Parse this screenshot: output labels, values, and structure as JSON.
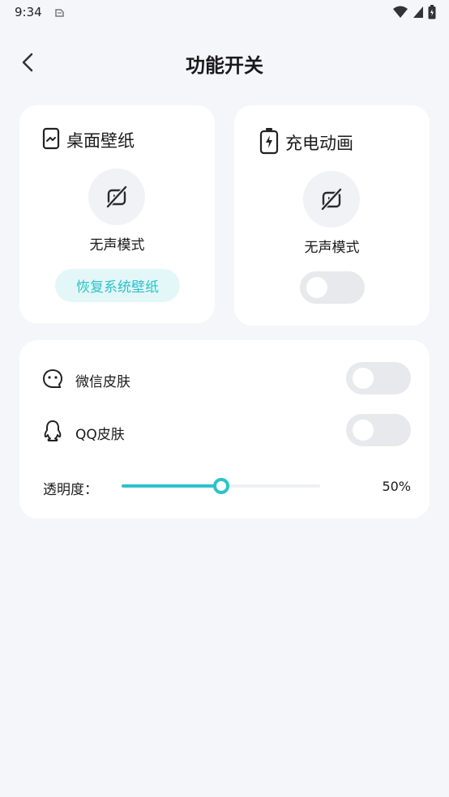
{
  "status_bar": {
    "time": "9:34"
  },
  "header": {
    "title": "功能开关"
  },
  "wallpaper_card": {
    "title": "桌面壁纸",
    "mode_label": "无声模式",
    "restore_button": "恢复系统壁纸"
  },
  "charging_card": {
    "title": "充电动画",
    "mode_label": "无声模式",
    "toggle_on": false
  },
  "skins": {
    "items": [
      {
        "label": "微信皮肤",
        "icon": "wechat-icon",
        "toggle_on": false
      },
      {
        "label": "QQ皮肤",
        "icon": "qq-icon",
        "toggle_on": false
      }
    ],
    "opacity_label": "透明度：",
    "opacity_value": 50,
    "opacity_value_text": "50%"
  },
  "colors": {
    "accent": "#2bc3ca",
    "accent_light": "#e4f7f8",
    "background": "#f5f6fa",
    "card": "#ffffff",
    "toggle_off": "#e8e9ec"
  }
}
